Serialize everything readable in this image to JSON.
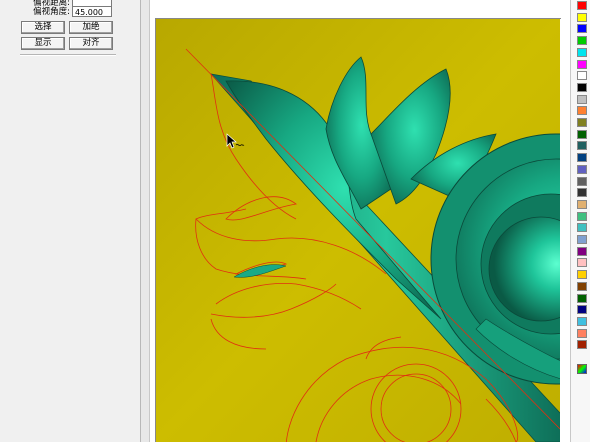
{
  "panel": {
    "field1_label": "偏视距离:",
    "field1_value": "",
    "field2_label": "偏视角度:",
    "field2_value": "45.000",
    "buttons": {
      "select": "选择",
      "add": "加绝",
      "show": "显示",
      "align": "对齐"
    }
  },
  "palette": {
    "colors": [
      "#ff0000",
      "#ffff00",
      "#0000ff",
      "#00cc00",
      "#00e5ee",
      "#ff00ff",
      "#ffffff",
      "#000000",
      "#c0c0c0",
      "#ff8030",
      "#808020",
      "#006000",
      "#206060",
      "#004080",
      "#6060c0",
      "#606060",
      "#303030",
      "#e0b070",
      "#40c080",
      "#40c0c0",
      "#80a0d0",
      "#800080",
      "#ffc0c0",
      "#ffd000",
      "#804000",
      "#006000",
      "#000080",
      "#40c0e0",
      "#ff8060",
      "#a02000"
    ],
    "icon": "palette-icon"
  },
  "canvas": {
    "background": "#c9b800",
    "relief_color": "#1aaa86",
    "curve_color": "#e03010"
  },
  "cursor": {
    "icon": "arrow-cursor-icon"
  }
}
